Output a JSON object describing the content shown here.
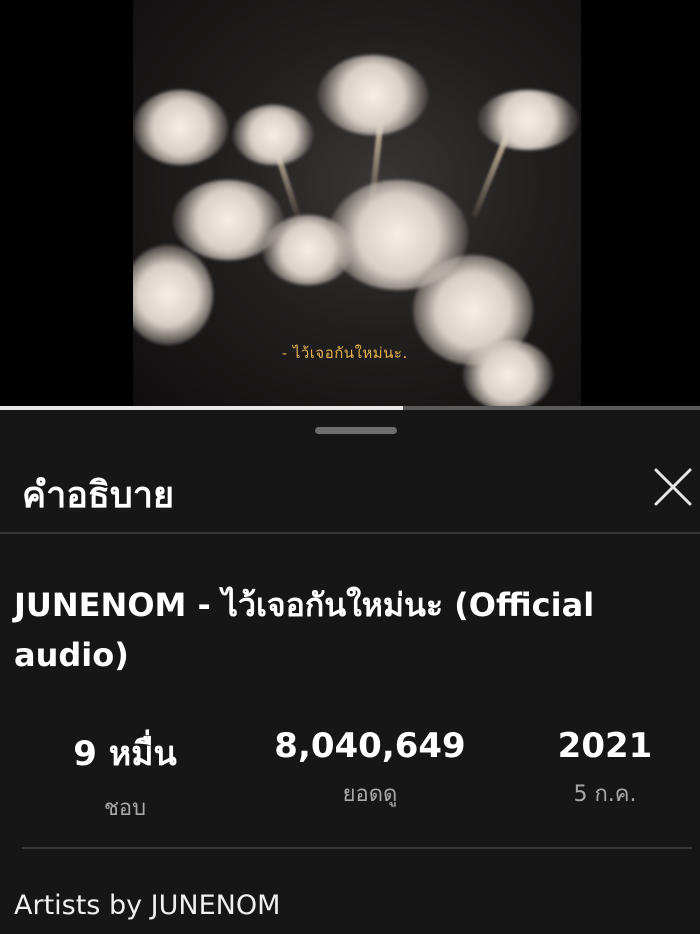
{
  "player": {
    "caption": "- ไว้เจอกันใหม่นะ.",
    "progress_fraction": 0.575
  },
  "sheet": {
    "title": "คำอธิบาย",
    "video_title": "JUNENOM - ไว้เจอกันใหม่นะ (Official audio)",
    "stats": [
      {
        "value": "9 หมื่น",
        "label": "ชอบ"
      },
      {
        "value": "8,040,649",
        "label": "ยอดดู"
      },
      {
        "value": "2021",
        "label": "5 ก.ค."
      }
    ],
    "description": "Artists by JUNENOM"
  },
  "icons": {
    "close": "close-icon"
  },
  "colors": {
    "sheet_background": "#161616",
    "caption_color": "#e6b24c",
    "secondary_text": "#a9a9a9"
  }
}
